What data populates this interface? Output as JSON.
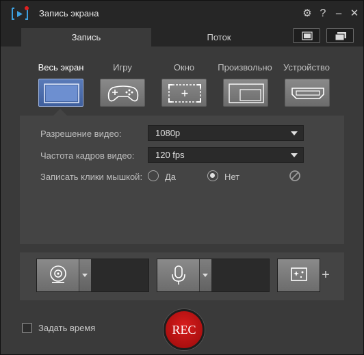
{
  "window": {
    "title": "Запись экрана"
  },
  "titlebar": {
    "gear": "⚙",
    "help": "?",
    "minimize": "–",
    "close": "✕"
  },
  "tabs": [
    {
      "label": "Запись",
      "active": true
    },
    {
      "label": "Поток",
      "active": false
    }
  ],
  "modes": [
    {
      "label": "Весь экран",
      "icon": "fullscreen-icon",
      "active": true
    },
    {
      "label": "Игру",
      "icon": "gamepad-icon",
      "active": false
    },
    {
      "label": "Окно",
      "icon": "window-select-icon",
      "active": false
    },
    {
      "label": "Произвольно",
      "icon": "custom-region-icon",
      "active": false
    },
    {
      "label": "Устройство",
      "icon": "hdmi-icon",
      "active": false
    }
  ],
  "settings": {
    "resolution_label": "Разрешение видео:",
    "resolution_value": "1080p",
    "fps_label": "Частота кадров видео:",
    "fps_value": "120 fps",
    "clicks_label": "Записать клики мышкой:",
    "clicks_yes": "Да",
    "clicks_no": "Нет",
    "clicks_selected": "Нет"
  },
  "devices": {
    "webcam_icon": "webcam-icon",
    "mic_icon": "microphone-icon",
    "effects_icon": "effects-icon",
    "plus": "+"
  },
  "bottom": {
    "set_time_label": "Задать время",
    "set_time_checked": false,
    "rec_label": "REC"
  },
  "colors": {
    "accent": "#4a6cab",
    "rec": "#c41414",
    "panel": "#444444",
    "background": "#3a3a3a"
  }
}
